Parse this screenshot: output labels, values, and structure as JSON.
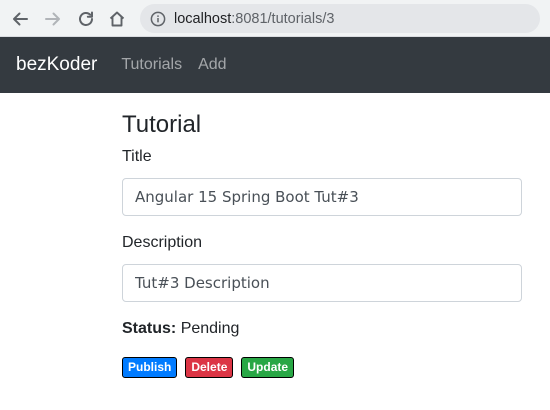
{
  "browser": {
    "url_host": "localhost",
    "url_path": ":8081/tutorials/3"
  },
  "navbar": {
    "brand": "bezKoder",
    "links": [
      "Tutorials",
      "Add"
    ]
  },
  "page": {
    "title": "Tutorial",
    "title_label": "Title",
    "title_value": "Angular 15 Spring Boot Tut#3",
    "description_label": "Description",
    "description_value": "Tut#3 Description",
    "status_label": "Status:",
    "status_value": "Pending"
  },
  "actions": {
    "publish": "Publish",
    "delete": "Delete",
    "update": "Update"
  },
  "colors": {
    "navbar": "#343a40",
    "primary": "#007bff",
    "danger": "#dc3545",
    "success": "#28a745"
  },
  "icons": [
    "back-arrow-icon",
    "forward-arrow-icon",
    "reload-icon",
    "home-icon",
    "info-icon"
  ]
}
